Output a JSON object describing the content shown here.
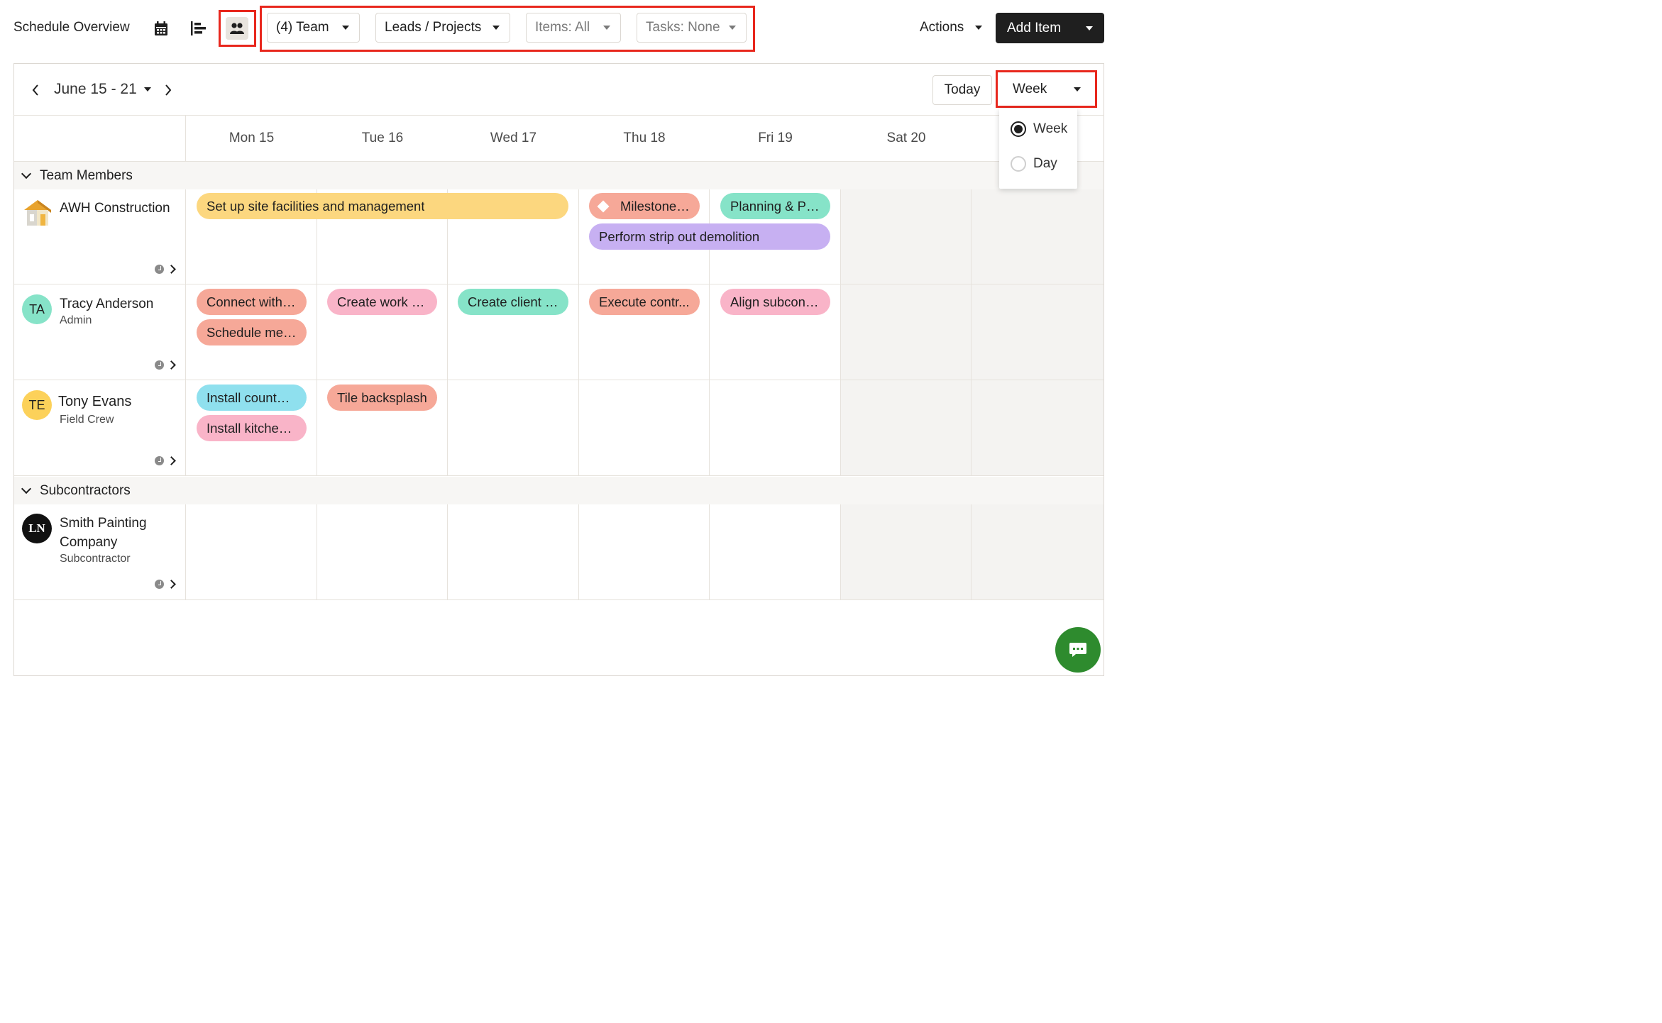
{
  "header": {
    "title": "Schedule Overview",
    "icons": [
      "calendar-icon",
      "gantt-icon",
      "team-icon"
    ],
    "filters": [
      {
        "label": "(4) Team"
      },
      {
        "label": "Leads / Projects"
      },
      {
        "label": "Items: All"
      },
      {
        "label": "Tasks: None"
      }
    ],
    "actions_label": "Actions",
    "add_item_label": "Add Item"
  },
  "calendar": {
    "date_range": "June 15 - 21",
    "today_label": "Today",
    "view_selected": "Week",
    "view_options": [
      {
        "label": "Week",
        "selected": true
      },
      {
        "label": "Day",
        "selected": false
      }
    ],
    "days": [
      "Mon 15",
      "Tue 16",
      "Wed 17",
      "Thu 18",
      "Fri 19",
      "Sat 20"
    ],
    "groups": [
      {
        "label": "Team Members"
      },
      {
        "label": "Subcontractors"
      }
    ],
    "resources": [
      {
        "name": "AWH Construction",
        "subtitle": "",
        "avatar": "house-logo-icon",
        "events": [
          {
            "label": "Set up site facilities and management",
            "color": "#fcd77f"
          },
          {
            "label": "Milestone: ...",
            "color": "#f6a898",
            "icon": "milestone-diamond-icon"
          },
          {
            "label": "Planning & Per...",
            "color": "#86e3c8"
          },
          {
            "label": "Perform strip out demolition",
            "color": "#c7b0f2"
          }
        ]
      },
      {
        "name": "Tracy Anderson",
        "subtitle": "Admin",
        "initials": "TA",
        "avatar_color": "#86e3c8",
        "events": [
          {
            "label": "Connect with ...",
            "color": "#f6a898"
          },
          {
            "label": "Schedule mee...",
            "color": "#f6a898"
          },
          {
            "label": "Create work s...",
            "color": "#f9b4c8"
          },
          {
            "label": "Create client p...",
            "color": "#86e3c8"
          },
          {
            "label": "Execute contr...",
            "color": "#f6a898"
          },
          {
            "label": "Align subcontr...",
            "color": "#f9b4c8"
          }
        ]
      },
      {
        "name": "Tony Evans",
        "subtitle": "Field Crew",
        "initials": "TE",
        "avatar_color": "#fcd15a",
        "events": [
          {
            "label": "Install counter...",
            "color": "#8fe0ee"
          },
          {
            "label": "Install kitchen ...",
            "color": "#f9b4c8"
          },
          {
            "label": "Tile backsplash",
            "color": "#f6a898"
          }
        ]
      },
      {
        "name_line1": "Smith Painting",
        "name_line2": "Company",
        "subtitle": "Subcontractor",
        "initials": "LN",
        "avatar_color": "#111111"
      }
    ]
  },
  "chat": {
    "icon": "chat-bubble-icon",
    "color": "#2e8b2e"
  }
}
